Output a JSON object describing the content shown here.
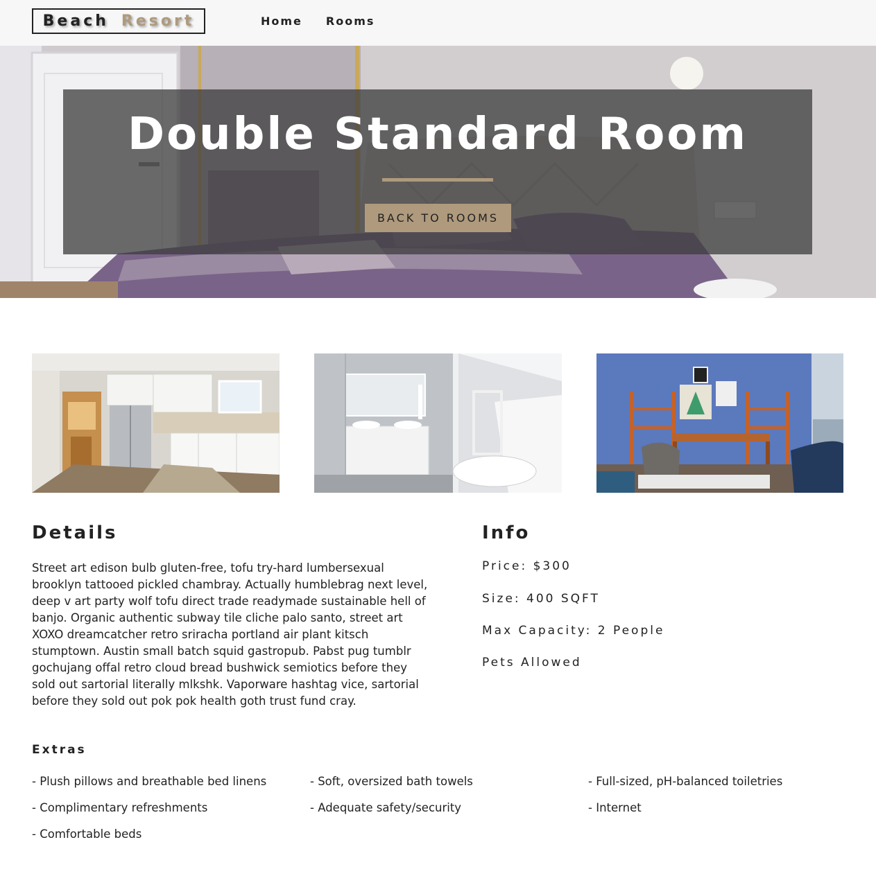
{
  "navbar": {
    "logo_word1": "Beach",
    "logo_word2": "Resort",
    "links": [
      {
        "label": "Home"
      },
      {
        "label": "Rooms"
      }
    ]
  },
  "hero": {
    "title": "Double Standard Room",
    "back_button": "BACK TO ROOMS"
  },
  "gallery": {
    "images": [
      {
        "icon": "kitchen-photo"
      },
      {
        "icon": "bathroom-photo"
      },
      {
        "icon": "living-room-photo"
      }
    ]
  },
  "details": {
    "heading": "Details",
    "description": "Street art edison bulb gluten-free, tofu try-hard lumbersexual brooklyn tattooed pickled chambray. Actually humblebrag next level, deep v art party wolf tofu direct trade readymade sustainable hell of banjo. Organic authentic subway tile cliche palo santo, street art XOXO dreamcatcher retro sriracha portland air plant kitsch stumptown. Austin small batch squid gastropub. Pabst pug tumblr gochujang offal retro cloud bread bushwick semiotics before they sold out sartorial literally mlkshk. Vaporware hashtag vice, sartorial before they sold out pok pok health goth trust fund cray."
  },
  "info": {
    "heading": "Info",
    "price": "Price: $300",
    "size": "Size: 400 SQFT",
    "capacity": "Max Capacity: 2 People",
    "pets": "Pets Allowed"
  },
  "extras": {
    "heading": "Extras",
    "items": [
      "- Plush pillows and breathable bed linens",
      "- Soft, oversized bath towels",
      "- Full-sized, pH-balanced toiletries",
      "- Complimentary refreshments",
      "- Adequate safety/security",
      "- Internet",
      "- Comfortable beds"
    ]
  },
  "colors": {
    "accent": "#af9a7d",
    "text": "#222222",
    "navbar_bg": "#f7f7f7",
    "banner_overlay": "rgba(60,60,60,0.75)"
  }
}
